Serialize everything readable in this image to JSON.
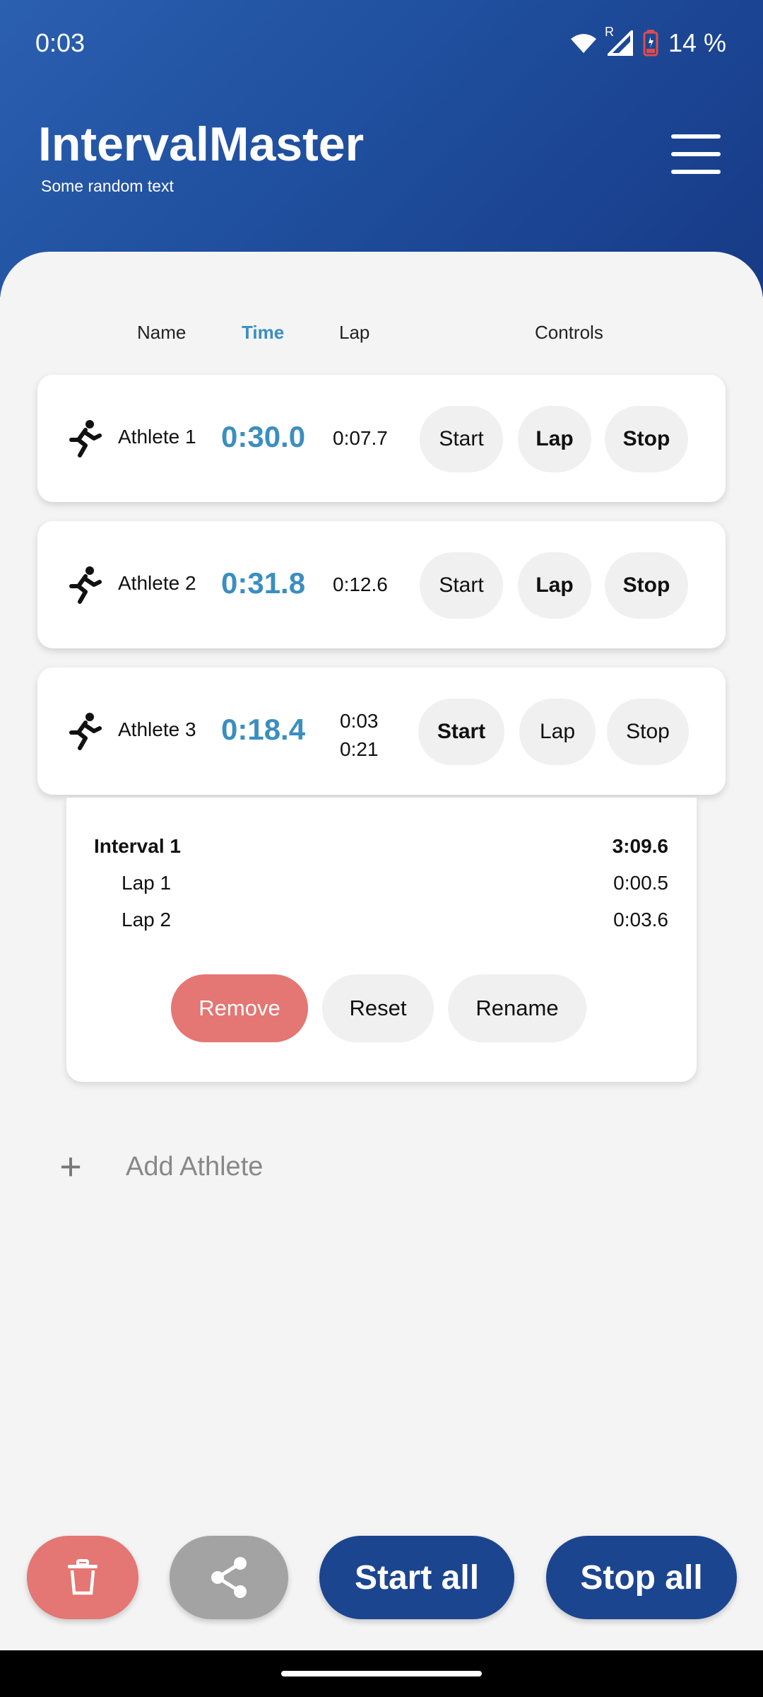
{
  "status": {
    "time": "0:03",
    "battery": "14 %",
    "network_indicator": "R"
  },
  "app": {
    "title": "IntervalMaster",
    "subtitle": "Some random text"
  },
  "columns": {
    "name": "Name",
    "time": "Time",
    "lap": "Lap",
    "controls": "Controls"
  },
  "athletes": [
    {
      "name": "Athlete 1",
      "time": "0:30.0",
      "lap": "0:07.7",
      "start": "Start",
      "lap_btn": "Lap",
      "stop": "Stop"
    },
    {
      "name": "Athlete 2",
      "time": "0:31.8",
      "lap": "0:12.6",
      "start": "Start",
      "lap_btn": "Lap",
      "stop": "Stop"
    },
    {
      "name": "Athlete 3",
      "time": "0:18.4",
      "lap_line1": "0:03",
      "lap_line2": "0:21",
      "start": "Start",
      "lap_btn": "Lap",
      "stop": "Stop"
    }
  ],
  "details": {
    "interval_label": "Interval 1",
    "interval_time": "3:09.6",
    "laps": [
      {
        "label": "Lap 1",
        "time": "0:00.5"
      },
      {
        "label": "Lap 2",
        "time": "0:03.6"
      }
    ],
    "remove": "Remove",
    "reset": "Reset",
    "rename": "Rename"
  },
  "add_athlete": {
    "label": "Add Athlete",
    "icon": "+"
  },
  "bottom": {
    "start_all": "Start all",
    "stop_all": "Stop all"
  },
  "colors": {
    "header_blue": "#1f4f9e",
    "accent_time": "#3b8ec0",
    "danger": "#e47673",
    "dark_blue_button": "#1c4590",
    "share_gray": "#a3a3a3"
  }
}
